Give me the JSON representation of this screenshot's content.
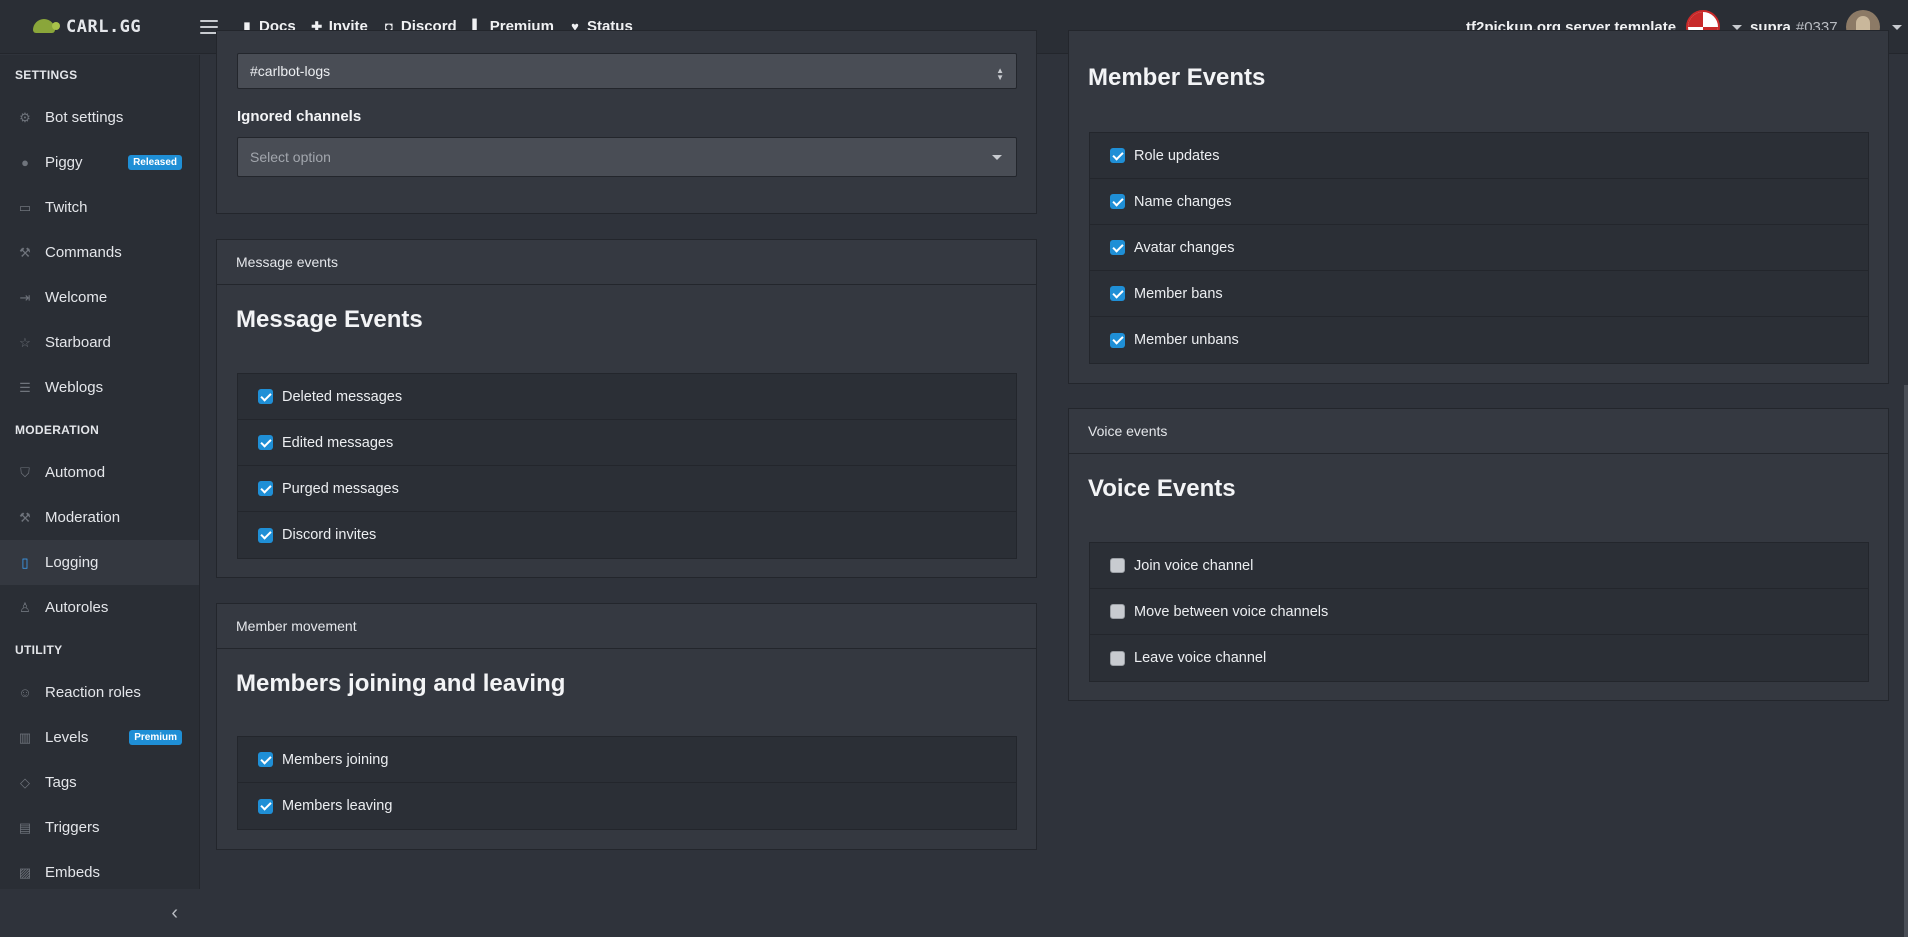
{
  "header": {
    "logo_text": "CARL.GG",
    "nav": [
      {
        "label": "Docs",
        "icon": "book-icon"
      },
      {
        "label": "Invite",
        "icon": "plus-icon"
      },
      {
        "label": "Discord",
        "icon": "discord-icon"
      },
      {
        "label": "Premium",
        "icon": "patreon-icon"
      },
      {
        "label": "Status",
        "icon": "heart-icon"
      }
    ],
    "server_name": "tf2pickup.org server template",
    "user_name": "supra",
    "user_discriminator": "#0337"
  },
  "sidebar": {
    "sections": [
      {
        "title": "SETTINGS",
        "items": [
          {
            "label": "Bot settings",
            "icon": "gear-icon"
          },
          {
            "label": "Piggy",
            "icon": "piggy-bank-icon",
            "badge": "Released"
          },
          {
            "label": "Twitch",
            "icon": "twitch-icon"
          },
          {
            "label": "Commands",
            "icon": "wrench-icon"
          },
          {
            "label": "Welcome",
            "icon": "sign-in-icon"
          },
          {
            "label": "Starboard",
            "icon": "star-icon"
          },
          {
            "label": "Weblogs",
            "icon": "list-icon"
          }
        ]
      },
      {
        "title": "MODERATION",
        "items": [
          {
            "label": "Automod",
            "icon": "shield-icon"
          },
          {
            "label": "Moderation",
            "icon": "hammer-icon"
          },
          {
            "label": "Logging",
            "icon": "book-icon",
            "active": true
          },
          {
            "label": "Autoroles",
            "icon": "user-icon"
          }
        ]
      },
      {
        "title": "UTILITY",
        "items": [
          {
            "label": "Reaction roles",
            "icon": "smile-icon"
          },
          {
            "label": "Levels",
            "icon": "bar-chart-icon",
            "badge": "Premium"
          },
          {
            "label": "Tags",
            "icon": "tag-icon"
          },
          {
            "label": "Triggers",
            "icon": "comment-icon"
          },
          {
            "label": "Embeds",
            "icon": "image-icon"
          }
        ]
      }
    ]
  },
  "log_channel": {
    "value": "#carlbot-logs",
    "ignored_label": "Ignored channels",
    "ignored_placeholder": "Select option"
  },
  "message_events": {
    "header": "Message events",
    "title": "Message Events",
    "items": [
      {
        "label": "Deleted messages",
        "checked": true
      },
      {
        "label": "Edited messages",
        "checked": true
      },
      {
        "label": "Purged messages",
        "checked": true
      },
      {
        "label": "Discord invites",
        "checked": true
      }
    ]
  },
  "member_movement": {
    "header": "Member movement",
    "title": "Members joining and leaving",
    "items": [
      {
        "label": "Members joining",
        "checked": true
      },
      {
        "label": "Members leaving",
        "checked": true
      }
    ]
  },
  "member_events": {
    "title": "Member Events",
    "items": [
      {
        "label": "Role updates",
        "checked": true
      },
      {
        "label": "Name changes",
        "checked": true
      },
      {
        "label": "Avatar changes",
        "checked": true
      },
      {
        "label": "Member bans",
        "checked": true
      },
      {
        "label": "Member unbans",
        "checked": true
      }
    ]
  },
  "voice_events": {
    "header": "Voice events",
    "title": "Voice Events",
    "items": [
      {
        "label": "Join voice channel",
        "checked": false
      },
      {
        "label": "Move between voice channels",
        "checked": false
      },
      {
        "label": "Leave voice channel",
        "checked": false
      }
    ]
  },
  "colors": {
    "accent": "#1f8fd6",
    "background": "#2f333b",
    "panel": "#343840"
  }
}
